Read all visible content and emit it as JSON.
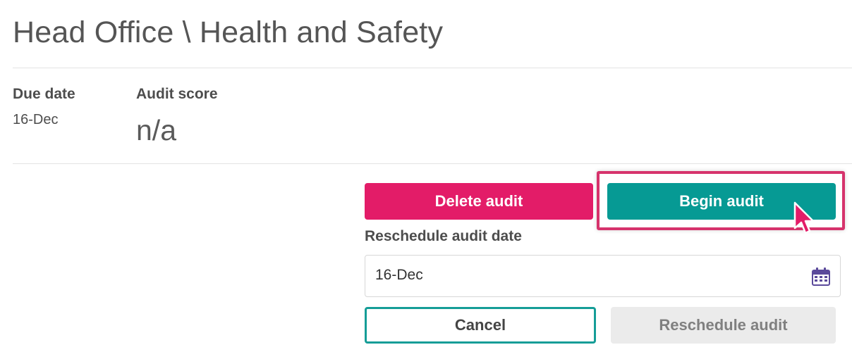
{
  "header": {
    "title": "Head Office \\ Health and Safety"
  },
  "summary": {
    "due_date_label": "Due date",
    "due_date_value": "16-Dec",
    "audit_score_label": "Audit score",
    "audit_score_value": "n/a"
  },
  "actions": {
    "delete_label": "Delete audit",
    "begin_label": "Begin audit"
  },
  "reschedule": {
    "label": "Reschedule audit date",
    "date_value": "16-Dec",
    "calendar_icon": "calendar-icon",
    "cancel_label": "Cancel",
    "reschedule_label": "Reschedule audit"
  },
  "colors": {
    "delete": "#e31c68",
    "begin": "#069a94",
    "highlight": "#d6336c",
    "calendar": "#5b4a9b"
  }
}
